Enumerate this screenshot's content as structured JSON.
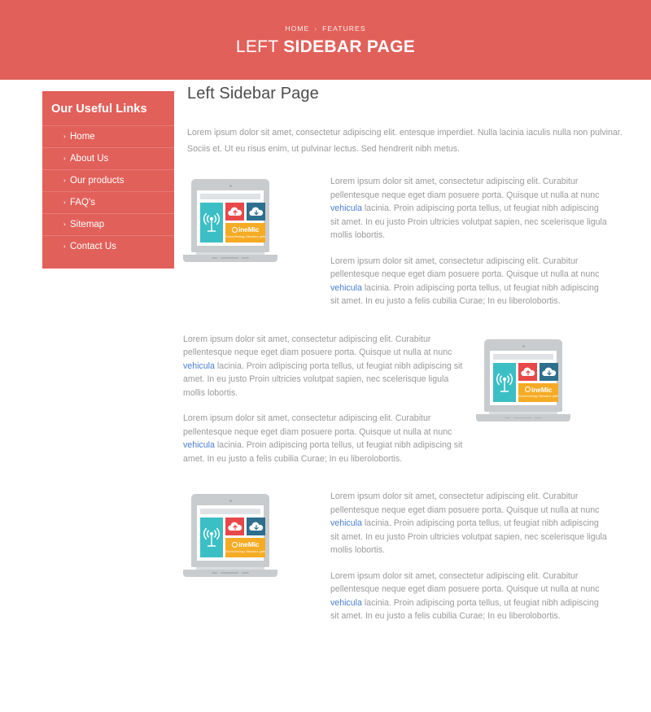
{
  "header": {
    "breadcrumb": {
      "home": "HOME",
      "separator": "›",
      "current": "FEATURES"
    },
    "title_light": "LEFT ",
    "title_bold": "SIDEBAR PAGE",
    "background_color": "#e2605a"
  },
  "sidebar": {
    "title": "Our Useful Links",
    "background_color": "#e2605a",
    "bullet": "›",
    "items": [
      {
        "label": "Home"
      },
      {
        "label": "About Us"
      },
      {
        "label": "Our products"
      },
      {
        "label": "FAQ's"
      },
      {
        "label": "Sitemap"
      },
      {
        "label": "Contact Us"
      }
    ]
  },
  "main": {
    "title": "Left Sidebar Page",
    "intro": "Lorem ipsum dolor sit amet, consectetur adipiscing elit. entesque imperdiet. Nulla lacinia iaculis nulla non pulvinar. Sociis et. Ut eu risus enim, ut pulvinar lectus. Sed hendrerit nibh metus.",
    "link_text": "vehicula",
    "link_color": "#4b7fd1",
    "paragraph_a_start": "Lorem ipsum dolor sit amet, consectetur adipiscing elit. Curabitur pellentesque neque eget diam posuere porta. Quisque ut nulla at nunc ",
    "paragraph_a_end": " lacinia. Proin adipiscing porta tellus, ut feugiat nibh adipiscing sit amet. In eu justo Proin ultricies volutpat sapien, nec scelerisque ligula mollis lobortis.",
    "paragraph_b_start": "Lorem ipsum dolor sit amet, consectetur adipiscing elit. Curabitur pellentesque neque eget diam posuere porta. Quisque ut nulla at nunc ",
    "paragraph_b_end": " lacinia. Proin adipiscing porta tellus, ut feugiat nibh adipiscing sit amet. In eu justo a felis cubilia Curae; In eu liberolobortis."
  },
  "illustration": {
    "brand_name": "ineMic",
    "tagline": "Solutchholegy Sliesaine grife",
    "colors": {
      "teal": "#3bbfc4",
      "red": "#e8484a",
      "blue": "#2e6f8e",
      "yellow": "#f5ab24",
      "chassis": "#c8ccce"
    }
  }
}
